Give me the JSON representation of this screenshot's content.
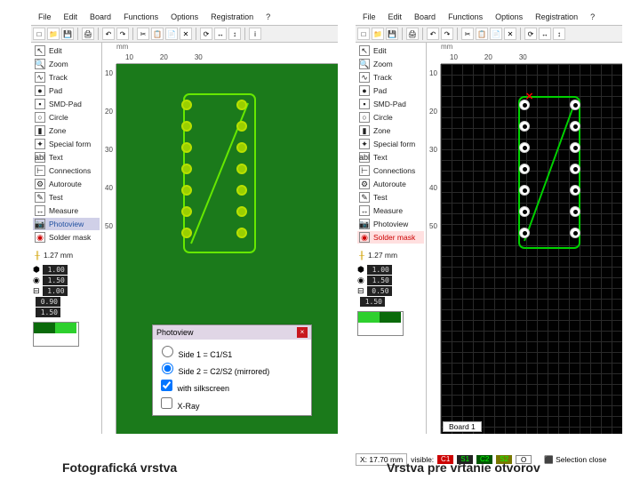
{
  "menus": [
    "File",
    "Edit",
    "Board",
    "Functions",
    "Options",
    "Registration",
    "?"
  ],
  "tools": [
    {
      "icon": "↖",
      "label": "Edit"
    },
    {
      "icon": "🔍",
      "label": "Zoom"
    },
    {
      "icon": "∿",
      "label": "Track"
    },
    {
      "icon": "●",
      "label": "Pad"
    },
    {
      "icon": "▪",
      "label": "SMD-Pad"
    },
    {
      "icon": "○",
      "label": "Circle"
    },
    {
      "icon": "▮",
      "label": "Zone"
    },
    {
      "icon": "✦",
      "label": "Special form"
    },
    {
      "icon": "abl",
      "label": "Text"
    },
    {
      "icon": "⊢",
      "label": "Connections"
    },
    {
      "icon": "⚙",
      "label": "Autoroute"
    },
    {
      "icon": "✎",
      "label": "Test"
    },
    {
      "icon": "↔",
      "label": "Measure"
    },
    {
      "icon": "📷",
      "label": "Photoview"
    },
    {
      "icon": "◉",
      "label": "Solder mask"
    }
  ],
  "grid_val": "1.27 mm",
  "small_vals": [
    "1.00",
    "1.50",
    "1.00",
    "0.90",
    "1.50"
  ],
  "small_vals_r": [
    "1.00",
    "1.50",
    "0.50",
    "1.50"
  ],
  "ruler_h": [
    "10",
    "20",
    "30"
  ],
  "ruler_v": [
    "10",
    "20",
    "30",
    "40",
    "50"
  ],
  "photoview": {
    "title": "Photoview",
    "side1": "Side 1 = C1/S1",
    "side2": "Side 2 = C2/S2 (mirrored)",
    "silk": "with silkscreen",
    "xray": "X-Ray"
  },
  "status_x": "X: 17.70 mm",
  "status_visible": "visible:",
  "status_c1": "C1",
  "status_s1": "S1",
  "status_c2": "C2",
  "status_s2": "S2",
  "status_o": "O",
  "status_sel": "Selection close",
  "board_tab": "Board 1",
  "caption_left": "Fotografická vrstva",
  "caption_right": "Vrstva pre vŕtanie otvorov",
  "mm": "mm"
}
